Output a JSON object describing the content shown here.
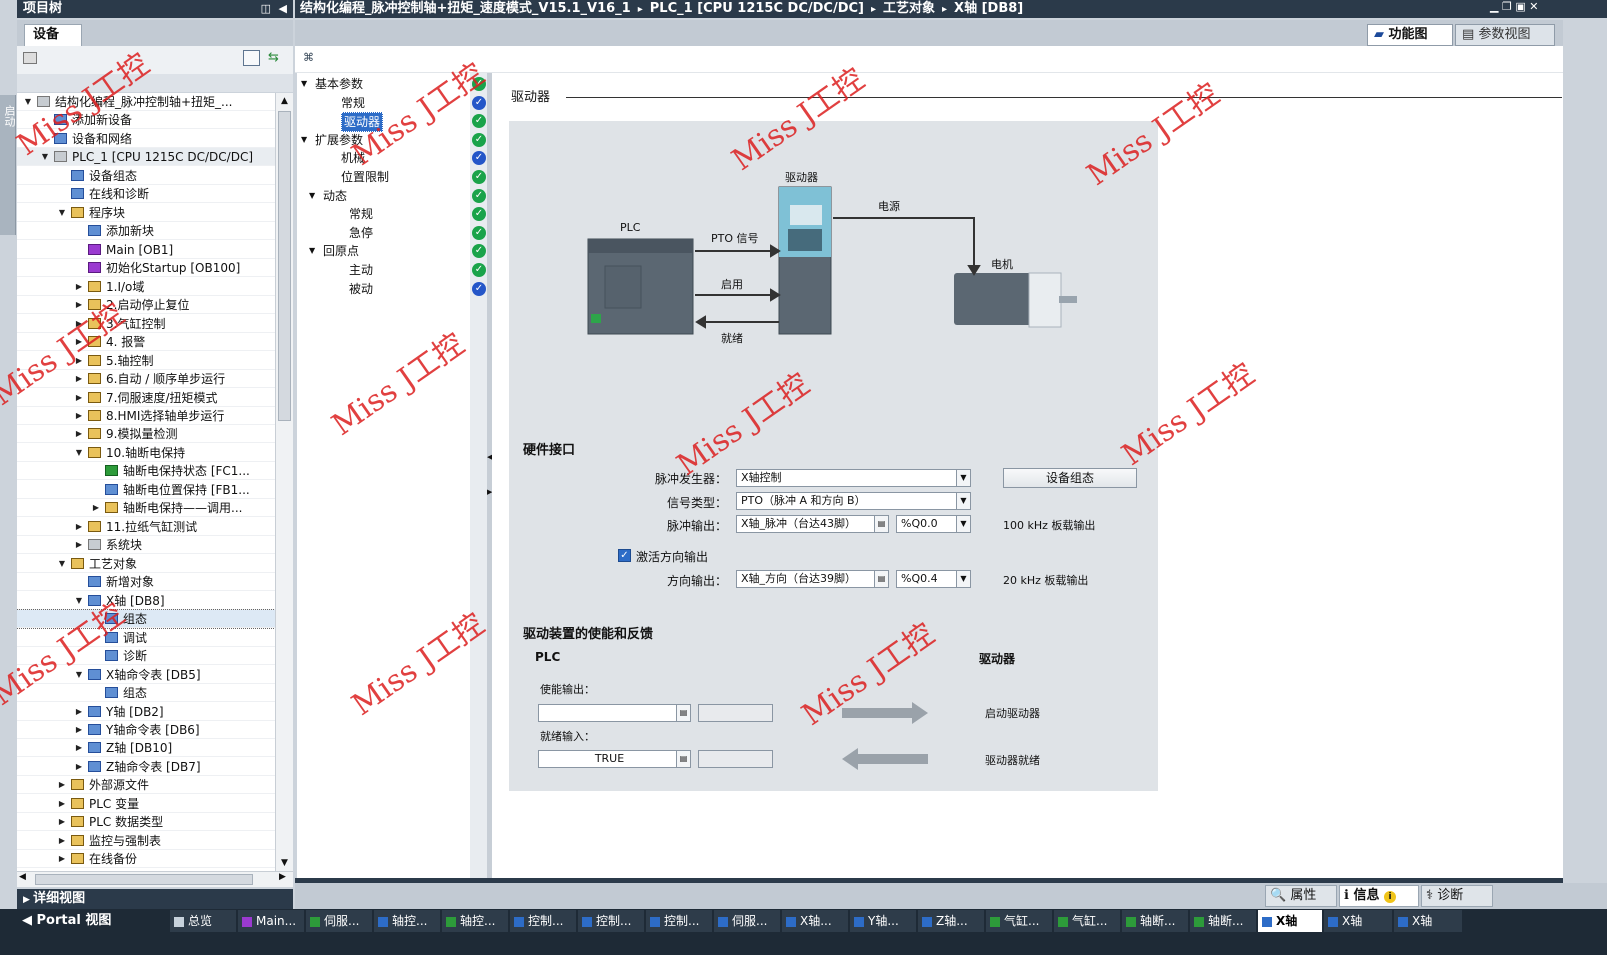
{
  "project_tree": {
    "title": "项目树",
    "tab": "设备",
    "rows": [
      {
        "label": "结构化编程_脉冲控制轴+扭矩_...",
        "indent": 0,
        "tri": "▼",
        "icon": "gray"
      },
      {
        "label": "添加新设备",
        "indent": 1,
        "tri": "",
        "icon": "blue"
      },
      {
        "label": "设备和网络",
        "indent": 1,
        "tri": "",
        "icon": "blue"
      },
      {
        "label": "PLC_1 [CPU 1215C DC/DC/DC]",
        "indent": 1,
        "tri": "▼",
        "icon": "gray"
      },
      {
        "label": "设备组态",
        "indent": 2,
        "tri": "",
        "icon": "blue"
      },
      {
        "label": "在线和诊断",
        "indent": 2,
        "tri": "",
        "icon": "blue"
      },
      {
        "label": "程序块",
        "indent": 2,
        "tri": "▼",
        "icon": ""
      },
      {
        "label": "添加新块",
        "indent": 3,
        "tri": "",
        "icon": "blue"
      },
      {
        "label": "Main [OB1]",
        "indent": 3,
        "tri": "",
        "icon": "purple"
      },
      {
        "label": "初始化Startup [OB100]",
        "indent": 3,
        "tri": "",
        "icon": "purple"
      },
      {
        "label": "1.I/o域",
        "indent": 3,
        "tri": "▶",
        "icon": ""
      },
      {
        "label": "2.启动停止复位",
        "indent": 3,
        "tri": "▶",
        "icon": ""
      },
      {
        "label": "3.气缸控制",
        "indent": 3,
        "tri": "▶",
        "icon": ""
      },
      {
        "label": "4. 报警",
        "indent": 3,
        "tri": "▶",
        "icon": ""
      },
      {
        "label": "5.轴控制",
        "indent": 3,
        "tri": "▶",
        "icon": ""
      },
      {
        "label": "6.自动 / 顺序单步运行",
        "indent": 3,
        "tri": "▶",
        "icon": ""
      },
      {
        "label": "7.伺服速度/扭矩模式",
        "indent": 3,
        "tri": "▶",
        "icon": ""
      },
      {
        "label": "8.HMI选择轴单步运行",
        "indent": 3,
        "tri": "▶",
        "icon": ""
      },
      {
        "label": "9.模拟量检测",
        "indent": 3,
        "tri": "▶",
        "icon": ""
      },
      {
        "label": "10.轴断电保持",
        "indent": 3,
        "tri": "▼",
        "icon": ""
      },
      {
        "label": "轴断电保持状态 [FC1...",
        "indent": 4,
        "tri": "",
        "icon": "green"
      },
      {
        "label": "轴断电位置保持 [FB1...",
        "indent": 4,
        "tri": "",
        "icon": "blue"
      },
      {
        "label": "轴断电保持——调用...",
        "indent": 4,
        "tri": "▶",
        "icon": ""
      },
      {
        "label": "11.拉纸气缸测试",
        "indent": 3,
        "tri": "▶",
        "icon": ""
      },
      {
        "label": "系统块",
        "indent": 3,
        "tri": "▶",
        "icon": "gray"
      },
      {
        "label": "工艺对象",
        "indent": 2,
        "tri": "▼",
        "icon": ""
      },
      {
        "label": "新增对象",
        "indent": 3,
        "tri": "",
        "icon": "blue"
      },
      {
        "label": "X轴 [DB8]",
        "indent": 3,
        "tri": "▼",
        "icon": "blue"
      },
      {
        "label": "组态",
        "indent": 4,
        "tri": "",
        "icon": "blue"
      },
      {
        "label": "调试",
        "indent": 4,
        "tri": "",
        "icon": "blue"
      },
      {
        "label": "诊断",
        "indent": 4,
        "tri": "",
        "icon": "blue"
      },
      {
        "label": "X轴命令表 [DB5]",
        "indent": 3,
        "tri": "▼",
        "icon": "blue"
      },
      {
        "label": "组态",
        "indent": 4,
        "tri": "",
        "icon": "blue"
      },
      {
        "label": "Y轴 [DB2]",
        "indent": 3,
        "tri": "▶",
        "icon": "blue"
      },
      {
        "label": "Y轴命令表 [DB6]",
        "indent": 3,
        "tri": "▶",
        "icon": "blue"
      },
      {
        "label": "Z轴 [DB10]",
        "indent": 3,
        "tri": "▶",
        "icon": "blue"
      },
      {
        "label": "Z轴命令表 [DB7]",
        "indent": 3,
        "tri": "▶",
        "icon": "blue"
      },
      {
        "label": "外部源文件",
        "indent": 2,
        "tri": "▶",
        "icon": ""
      },
      {
        "label": "PLC 变量",
        "indent": 2,
        "tri": "▶",
        "icon": ""
      },
      {
        "label": "PLC 数据类型",
        "indent": 2,
        "tri": "▶",
        "icon": ""
      },
      {
        "label": "监控与强制表",
        "indent": 2,
        "tri": "▶",
        "icon": ""
      },
      {
        "label": "在线备份",
        "indent": 2,
        "tri": "▶",
        "icon": ""
      }
    ],
    "details_view": "详细视图",
    "side_tab": "启动"
  },
  "header": {
    "breadcrumb": [
      "结构化编程_脉冲控制轴+扭矩_速度模式_V15.1_V16_1",
      "PLC_1 [CPU 1215C DC/DC/DC]",
      "工艺对象",
      "X轴 [DB8]"
    ],
    "sep": "▸",
    "func_view": "功能图",
    "param_view": "参数视图"
  },
  "nav": {
    "rows": [
      {
        "label": "基本参数",
        "indent": 0,
        "tri": "▼",
        "check": "g"
      },
      {
        "label": "常规",
        "indent": 2,
        "tri": "",
        "check": "b"
      },
      {
        "label": "驱动器",
        "indent": 2,
        "tri": "",
        "check": "g",
        "selected": true
      },
      {
        "label": "扩展参数",
        "indent": 0,
        "tri": "▼",
        "check": "g"
      },
      {
        "label": "机械",
        "indent": 2,
        "tri": "",
        "check": "b"
      },
      {
        "label": "位置限制",
        "indent": 2,
        "tri": "",
        "check": "g"
      },
      {
        "label": "动态",
        "indent": 1,
        "tri": "▼",
        "check": "g"
      },
      {
        "label": "常规",
        "indent": 3,
        "tri": "",
        "check": "g"
      },
      {
        "label": "急停",
        "indent": 3,
        "tri": "",
        "check": "g"
      },
      {
        "label": "回原点",
        "indent": 1,
        "tri": "▼",
        "check": "g"
      },
      {
        "label": "主动",
        "indent": 3,
        "tri": "",
        "check": "g"
      },
      {
        "label": "被动",
        "indent": 3,
        "tri": "",
        "check": "b"
      }
    ],
    "check_mark": "✓"
  },
  "content": {
    "section_title": "驱动器",
    "diagram": {
      "plc": "PLC",
      "pto": "PTO 信号",
      "enable": "启用",
      "ready": "就绪",
      "drive": "驱动器",
      "power": "电源",
      "motor": "电机"
    },
    "hw": {
      "title": "硬件接口",
      "pulse_gen_label": "脉冲发生器：",
      "pulse_gen_value": "X轴控制",
      "device_config_btn": "设备组态",
      "signal_type_label": "信号类型：",
      "signal_type_value": "PTO（脉冲 A 和方向 B）",
      "pulse_out_label": "脉冲输出：",
      "pulse_out_value": "X轴_脉冲（台达43脚）",
      "pulse_out_addr": "%Q0.0",
      "pulse_out_note": "100 kHz 板载输出",
      "dir_enable_label": "激活方向输出",
      "dir_out_label": "方向输出：",
      "dir_out_value": "X轴_方向（台达39脚）",
      "dir_out_addr": "%Q0.4",
      "dir_out_note": "20 kHz 板载输出"
    },
    "enable": {
      "title": "驱动装置的使能和反馈",
      "plc_label": "PLC",
      "drive_label": "驱动器",
      "enable_out_label": "使能输出：",
      "enable_out_value": "",
      "ready_in_label": "就绪输入：",
      "ready_in_value": "TRUE",
      "start_drive": "启动驱动器",
      "drive_ready": "驱动器就绪"
    }
  },
  "statusbar": {
    "properties": "属性",
    "info": "信息",
    "diagnostics": "诊断"
  },
  "taskbar": {
    "portal": "Portal 视图",
    "items": [
      "总览",
      "Main...",
      "伺服...",
      "轴控...",
      "轴控...",
      "控制...",
      "控制...",
      "控制...",
      "伺服...",
      "X轴...",
      "Y轴...",
      "Z轴...",
      "气缸...",
      "气缸...",
      "轴断...",
      "轴断...",
      "X轴",
      "X轴",
      "X轴"
    ]
  },
  "watermark": "Miss J工控"
}
